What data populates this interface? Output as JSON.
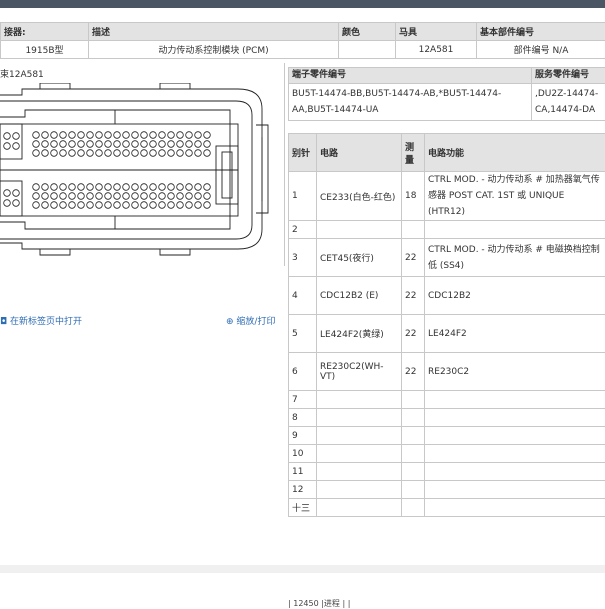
{
  "header": {
    "columns": [
      "接器:",
      "描述",
      "颜色",
      "马具",
      "基本部件编号"
    ],
    "values": [
      "1915B型",
      "动力传动系控制模块 (PCM)",
      "",
      "12A581",
      "部件编号 N/A"
    ]
  },
  "connector": {
    "title_partial": "束12A581",
    "open_in_tab": "在新标签页中打开",
    "zoom_print": "缩放/打印"
  },
  "parts": {
    "terminal_header": "端子零件编号",
    "service_header": "服务零件编号",
    "terminal_value": "BU5T-14474-BB,BU5T-14474-AB,*BU5T-14474-AA,BU5T-14474-UA",
    "service_value": ",DU2Z-14474-CA,14474-DA"
  },
  "pins": {
    "headers": [
      "别针",
      "电路",
      "测量",
      "电路功能"
    ],
    "rows": [
      {
        "pin": "1",
        "circuit": "CE233(白色-红色)",
        "gauge": "18",
        "function": "CTRL MOD. - 动力传动系 # 加热器氧气传感器 POST CAT. 1ST 或 UNIQUE (HTR12)"
      },
      {
        "pin": "2",
        "circuit": "",
        "gauge": "",
        "function": ""
      },
      {
        "pin": "3",
        "circuit": "CET45(夜行)",
        "gauge": "22",
        "function": "CTRL MOD. - 动力传动系 # 电磁换档控制低 (SS4)"
      },
      {
        "pin": "4",
        "circuit": "CDC12B2 (E)",
        "gauge": "22",
        "function": "CDC12B2"
      },
      {
        "pin": "5",
        "circuit": "LE424F2(黄绿)",
        "gauge": "22",
        "function": "LE424F2"
      },
      {
        "pin": "6",
        "circuit": "RE230C2(WH-VT)",
        "gauge": "22",
        "function": "RE230C2"
      },
      {
        "pin": "7",
        "circuit": "",
        "gauge": "",
        "function": ""
      },
      {
        "pin": "8",
        "circuit": "",
        "gauge": "",
        "function": ""
      },
      {
        "pin": "9",
        "circuit": "",
        "gauge": "",
        "function": ""
      },
      {
        "pin": "10",
        "circuit": "",
        "gauge": "",
        "function": ""
      },
      {
        "pin": "11",
        "circuit": "",
        "gauge": "",
        "function": ""
      },
      {
        "pin": "12",
        "circuit": "",
        "gauge": "",
        "function": ""
      },
      {
        "pin": "十三",
        "circuit": "",
        "gauge": "",
        "function": ""
      }
    ]
  },
  "footer": {
    "partial_text": "| 12450 |进程 | |"
  }
}
